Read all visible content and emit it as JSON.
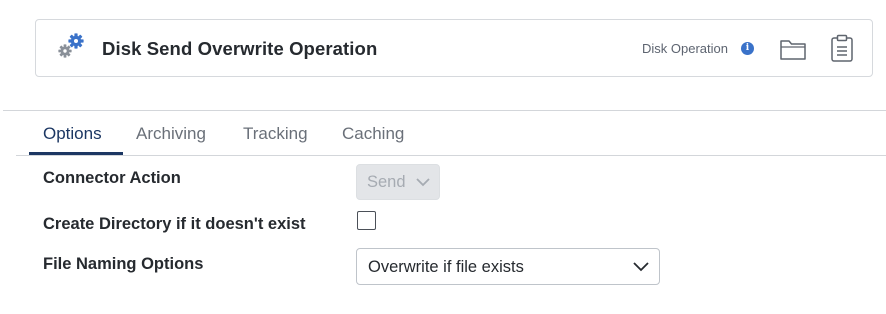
{
  "header": {
    "title": "Disk Send Overwrite Operation",
    "type_label": "Disk Operation",
    "info_glyph": "i",
    "icons": {
      "main": "gears-icon",
      "folder": "folder-icon",
      "clipboard": "clipboard-icon",
      "info": "info-icon"
    },
    "accent_color": "#3a72c9"
  },
  "tabs": [
    {
      "label": "Options",
      "active": true
    },
    {
      "label": "Archiving",
      "active": false
    },
    {
      "label": "Tracking",
      "active": false
    },
    {
      "label": "Caching",
      "active": false
    }
  ],
  "form": {
    "connector_action": {
      "label": "Connector Action",
      "value": "Send",
      "disabled": true
    },
    "create_directory": {
      "label": "Create Directory if it doesn't exist",
      "checked": false
    },
    "file_naming": {
      "label": "File Naming Options",
      "value": "Overwrite if file exists"
    }
  },
  "colors": {
    "tab_active": "#1c3763",
    "tab_inactive": "#6a7079",
    "border": "#d6d9dd"
  }
}
